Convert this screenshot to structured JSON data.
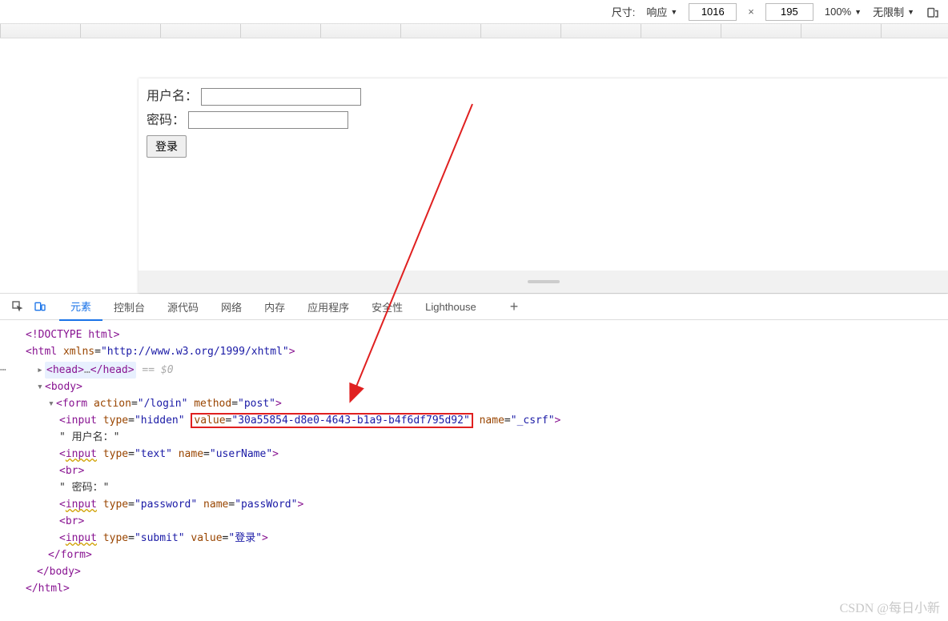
{
  "toolbar": {
    "size_label": "尺寸:",
    "responsive": "响应",
    "width": "1016",
    "height": "195",
    "zoom": "100%",
    "throttle": "无限制"
  },
  "form": {
    "username_label": "用户名：",
    "password_label": "密码：",
    "submit": "登录"
  },
  "devtools": {
    "tabs": [
      "元素",
      "控制台",
      "源代码",
      "网络",
      "内存",
      "应用程序",
      "安全性",
      "Lighthouse"
    ]
  },
  "dom": {
    "doctype": "<!DOCTYPE html>",
    "html_open": "html",
    "xmlns_attr": "xmlns",
    "xmlns_val": "http://www.w3.org/1999/xhtml",
    "head": "head",
    "head_ellipsis": "…",
    "eq0": " == $0",
    "body": "body",
    "form": "form",
    "action_attr": "action",
    "action_val": "/login",
    "method_attr": "method",
    "method_val": "post",
    "input": "input",
    "type_attr": "type",
    "hidden": "hidden",
    "value_attr": "value",
    "csrf_val": "30a55854-d8e0-4643-b1a9-b4f6df795d92",
    "name_attr": "name",
    "csrf_name": "_csrf",
    "username_text": "\" 用户名：\"",
    "text": "text",
    "userName": "userName",
    "br": "br",
    "password_text": "\" 密码：\"",
    "password": "password",
    "passWord": "passWord",
    "submit": "submit",
    "submit_val": "登录"
  },
  "watermark": "CSDN @每日小新"
}
